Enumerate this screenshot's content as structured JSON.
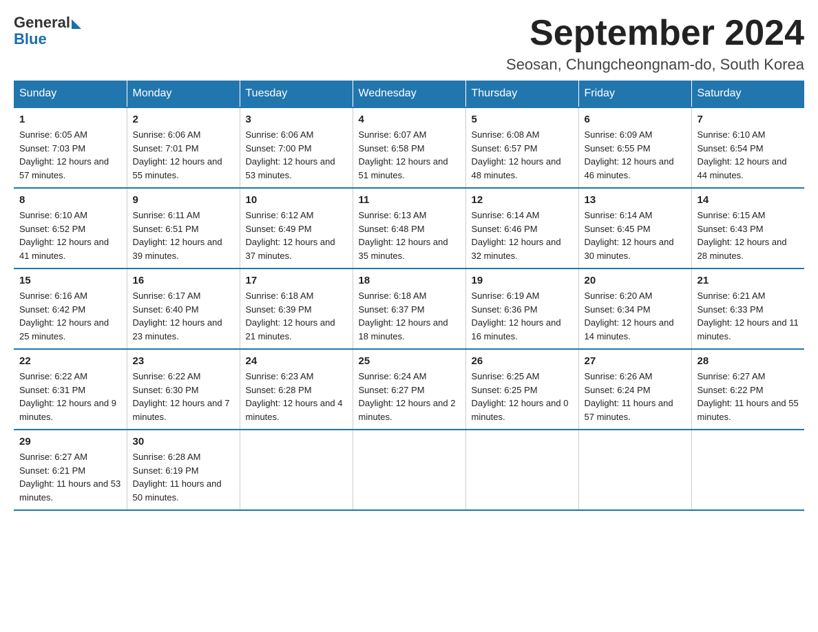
{
  "logo": {
    "general": "General",
    "blue": "Blue"
  },
  "calendar": {
    "title": "September 2024",
    "subtitle": "Seosan, Chungcheongnam-do, South Korea"
  },
  "headers": [
    "Sunday",
    "Monday",
    "Tuesday",
    "Wednesday",
    "Thursday",
    "Friday",
    "Saturday"
  ],
  "weeks": [
    [
      {
        "day": "1",
        "sunrise": "6:05 AM",
        "sunset": "7:03 PM",
        "daylight": "12 hours and 57 minutes."
      },
      {
        "day": "2",
        "sunrise": "6:06 AM",
        "sunset": "7:01 PM",
        "daylight": "12 hours and 55 minutes."
      },
      {
        "day": "3",
        "sunrise": "6:06 AM",
        "sunset": "7:00 PM",
        "daylight": "12 hours and 53 minutes."
      },
      {
        "day": "4",
        "sunrise": "6:07 AM",
        "sunset": "6:58 PM",
        "daylight": "12 hours and 51 minutes."
      },
      {
        "day": "5",
        "sunrise": "6:08 AM",
        "sunset": "6:57 PM",
        "daylight": "12 hours and 48 minutes."
      },
      {
        "day": "6",
        "sunrise": "6:09 AM",
        "sunset": "6:55 PM",
        "daylight": "12 hours and 46 minutes."
      },
      {
        "day": "7",
        "sunrise": "6:10 AM",
        "sunset": "6:54 PM",
        "daylight": "12 hours and 44 minutes."
      }
    ],
    [
      {
        "day": "8",
        "sunrise": "6:10 AM",
        "sunset": "6:52 PM",
        "daylight": "12 hours and 41 minutes."
      },
      {
        "day": "9",
        "sunrise": "6:11 AM",
        "sunset": "6:51 PM",
        "daylight": "12 hours and 39 minutes."
      },
      {
        "day": "10",
        "sunrise": "6:12 AM",
        "sunset": "6:49 PM",
        "daylight": "12 hours and 37 minutes."
      },
      {
        "day": "11",
        "sunrise": "6:13 AM",
        "sunset": "6:48 PM",
        "daylight": "12 hours and 35 minutes."
      },
      {
        "day": "12",
        "sunrise": "6:14 AM",
        "sunset": "6:46 PM",
        "daylight": "12 hours and 32 minutes."
      },
      {
        "day": "13",
        "sunrise": "6:14 AM",
        "sunset": "6:45 PM",
        "daylight": "12 hours and 30 minutes."
      },
      {
        "day": "14",
        "sunrise": "6:15 AM",
        "sunset": "6:43 PM",
        "daylight": "12 hours and 28 minutes."
      }
    ],
    [
      {
        "day": "15",
        "sunrise": "6:16 AM",
        "sunset": "6:42 PM",
        "daylight": "12 hours and 25 minutes."
      },
      {
        "day": "16",
        "sunrise": "6:17 AM",
        "sunset": "6:40 PM",
        "daylight": "12 hours and 23 minutes."
      },
      {
        "day": "17",
        "sunrise": "6:18 AM",
        "sunset": "6:39 PM",
        "daylight": "12 hours and 21 minutes."
      },
      {
        "day": "18",
        "sunrise": "6:18 AM",
        "sunset": "6:37 PM",
        "daylight": "12 hours and 18 minutes."
      },
      {
        "day": "19",
        "sunrise": "6:19 AM",
        "sunset": "6:36 PM",
        "daylight": "12 hours and 16 minutes."
      },
      {
        "day": "20",
        "sunrise": "6:20 AM",
        "sunset": "6:34 PM",
        "daylight": "12 hours and 14 minutes."
      },
      {
        "day": "21",
        "sunrise": "6:21 AM",
        "sunset": "6:33 PM",
        "daylight": "12 hours and 11 minutes."
      }
    ],
    [
      {
        "day": "22",
        "sunrise": "6:22 AM",
        "sunset": "6:31 PM",
        "daylight": "12 hours and 9 minutes."
      },
      {
        "day": "23",
        "sunrise": "6:22 AM",
        "sunset": "6:30 PM",
        "daylight": "12 hours and 7 minutes."
      },
      {
        "day": "24",
        "sunrise": "6:23 AM",
        "sunset": "6:28 PM",
        "daylight": "12 hours and 4 minutes."
      },
      {
        "day": "25",
        "sunrise": "6:24 AM",
        "sunset": "6:27 PM",
        "daylight": "12 hours and 2 minutes."
      },
      {
        "day": "26",
        "sunrise": "6:25 AM",
        "sunset": "6:25 PM",
        "daylight": "12 hours and 0 minutes."
      },
      {
        "day": "27",
        "sunrise": "6:26 AM",
        "sunset": "6:24 PM",
        "daylight": "11 hours and 57 minutes."
      },
      {
        "day": "28",
        "sunrise": "6:27 AM",
        "sunset": "6:22 PM",
        "daylight": "11 hours and 55 minutes."
      }
    ],
    [
      {
        "day": "29",
        "sunrise": "6:27 AM",
        "sunset": "6:21 PM",
        "daylight": "11 hours and 53 minutes."
      },
      {
        "day": "30",
        "sunrise": "6:28 AM",
        "sunset": "6:19 PM",
        "daylight": "11 hours and 50 minutes."
      },
      null,
      null,
      null,
      null,
      null
    ]
  ],
  "labels": {
    "sunrise": "Sunrise: ",
    "sunset": "Sunset: ",
    "daylight": "Daylight: "
  }
}
